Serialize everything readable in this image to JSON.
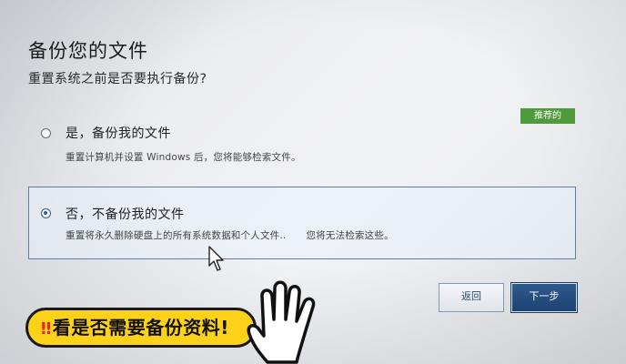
{
  "window": {
    "title": "备份您的文件",
    "question": "重置系统之前是否要执行备份?"
  },
  "options": [
    {
      "label": "是，备份我的文件",
      "description": "重置计算机并设置 Windows 后，您将能够检索文件。",
      "badge": "推荐的",
      "selected": false
    },
    {
      "label": "否，不备份我的文件",
      "description_part1": "重置将永久删除硬盘上的所有系统数据和个人文件..",
      "description_part2": "您将无法检索这些。",
      "selected": true
    }
  ],
  "buttons": {
    "back": "返回",
    "next": "下一步"
  },
  "overlay": {
    "caption_mark": "‼",
    "caption": "看是否需要备份资料!"
  },
  "colors": {
    "badge": "#4f9a3c",
    "selection_border": "#5b7fa6",
    "primary_button": "#1d4272",
    "caption_bg": "#ffd21a"
  },
  "icons": {
    "cursor": "mouse-pointer-icon",
    "hand": "pointing-hand-icon"
  }
}
